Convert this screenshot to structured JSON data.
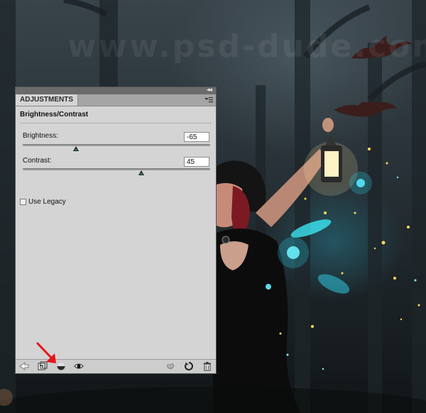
{
  "watermark": "www.psd-dude.com",
  "panel": {
    "tab_label": "ADJUSTMENTS",
    "collapse_glyph": "◂◂",
    "title": "Brightness/Contrast",
    "brightness": {
      "label": "Brightness:",
      "value": "-65",
      "min": -150,
      "max": 150,
      "level": -65
    },
    "contrast": {
      "label": "Contrast:",
      "value": "45",
      "min": -50,
      "max": 100,
      "level": 45
    },
    "use_legacy": {
      "label": "Use Legacy",
      "checked": false
    },
    "footer_icons": [
      "back-arrow-icon",
      "clip-to-layer-icon",
      "visibility-toggle-icon",
      "eye-icon",
      "view-previous-icon",
      "reset-icon",
      "trash-icon"
    ]
  },
  "colors": {
    "panel_bg": "#d4d4d4",
    "annotation_arrow": "#e8141b",
    "slider_thumb_accent": "#2fa35a"
  }
}
